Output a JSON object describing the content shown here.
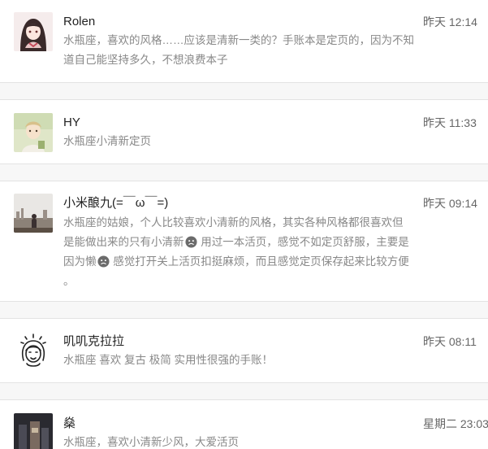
{
  "comments": [
    {
      "user": "Rolen",
      "time": "昨天 12:14",
      "lines": [
        "水瓶座，喜欢的风格……应该是清新一类的？手账本是定页的，因为不知",
        "道自己能坚持多久，不想浪费本子"
      ]
    },
    {
      "user": "HY",
      "time": "昨天 11:33",
      "lines": [
        "水瓶座小清新定页"
      ]
    },
    {
      "user": "小米酿九(=￣ω￣=)",
      "time": "昨天 09:14",
      "line1": "水瓶座的姑娘，个人比较喜欢小清新的风格，其实各种风格都很喜欢但",
      "line2a": "是能做出来的只有小清新",
      "line2b": " 用过一本活页，感觉不如定页舒服，主要是",
      "line3a": "因为懒",
      "line3b": " 感觉打开关上活页扣挺麻烦，而且感觉定页保存起来比较方便",
      "line4": "。"
    },
    {
      "user": "叽叽克拉拉",
      "time": "昨天 08:11",
      "lines": [
        "水瓶座 喜欢 复古 极简 实用性很强的手账！"
      ]
    },
    {
      "user": "燊",
      "time": "星期二 23:03",
      "lines": [
        "水瓶座，喜欢小清新少风，大爱活页"
      ]
    }
  ],
  "icons": {
    "emoji": "sad-face-emoji-icon"
  },
  "colors": {
    "username": "#222222",
    "text": "#888888",
    "timestamp": "#666666",
    "divider": "#e3e3e3"
  }
}
